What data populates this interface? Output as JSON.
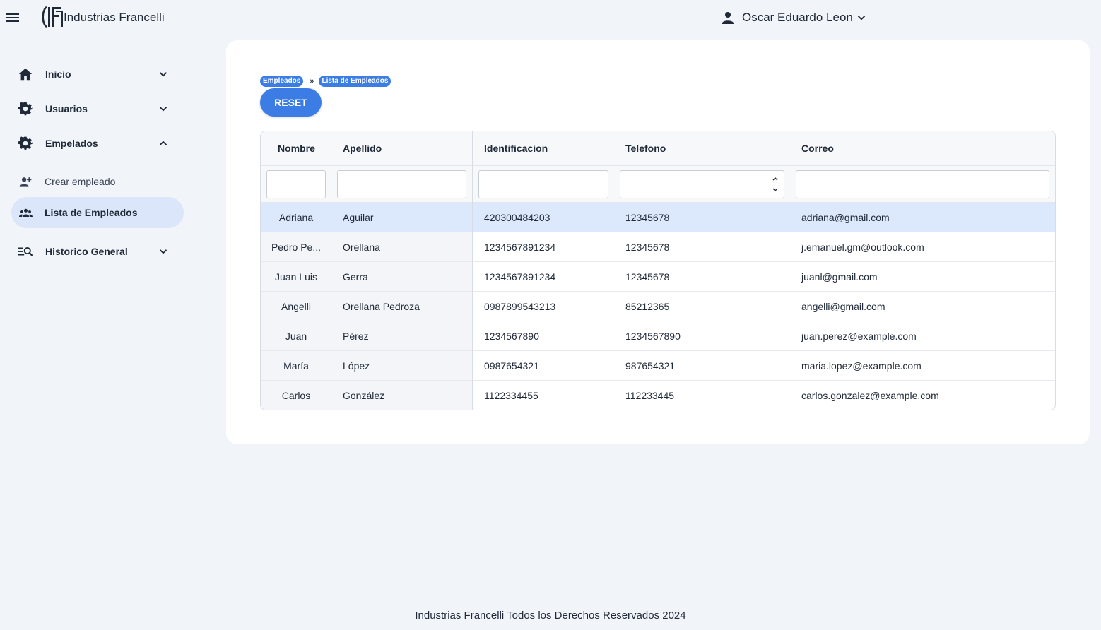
{
  "header": {
    "brand": "Industrias Francelli",
    "user_name": "Oscar Eduardo Leon"
  },
  "sidebar": {
    "items": [
      {
        "label": "Inicio",
        "icon": "home-icon"
      },
      {
        "label": "Usuarios",
        "icon": "gear-icon"
      },
      {
        "label": "Empelados",
        "icon": "gear-icon"
      },
      {
        "label": "Crear empleado",
        "icon": "person-add-icon"
      },
      {
        "label": "Lista de Empleados",
        "icon": "people-icon"
      },
      {
        "label": "Historico General",
        "icon": "list-search-icon"
      }
    ]
  },
  "breadcrumb": [
    "Empleados",
    "Lista de Empleados"
  ],
  "breadcrumb_sep": "»",
  "reset_label": "RESET",
  "table": {
    "columns": [
      "Nombre",
      "Apellido",
      "Identificacion",
      "Telefono",
      "Correo"
    ],
    "rows": [
      [
        "Adriana",
        "Aguilar",
        "420300484203",
        "12345678",
        "adriana@gmail.com"
      ],
      [
        "Pedro Pe...",
        "Orellana",
        "1234567891234",
        "12345678",
        "j.emanuel.gm@outlook.com"
      ],
      [
        "Juan Luis",
        "Gerra",
        "1234567891234",
        "12345678",
        "juanl@gmail.com"
      ],
      [
        "Angelli",
        "Orellana Pedroza",
        "0987899543213",
        "85212365",
        "angelli@gmail.com"
      ],
      [
        "Juan",
        "Pérez",
        "1234567890",
        "1234567890",
        "juan.perez@example.com"
      ],
      [
        "María",
        "López",
        "0987654321",
        "987654321",
        "maria.lopez@example.com"
      ],
      [
        "Carlos",
        "González",
        "1122334455",
        "112233445",
        "carlos.gonzalez@example.com"
      ]
    ],
    "selected_row": 0
  },
  "footer": "Industrias Francelli Todos los Derechos Reservados 2024",
  "colors": {
    "accent": "#3b7de4",
    "active_nav_bg": "#dbe6fb",
    "selected_row_bg": "#dce8fc",
    "page_bg": "#f1f4f9"
  }
}
